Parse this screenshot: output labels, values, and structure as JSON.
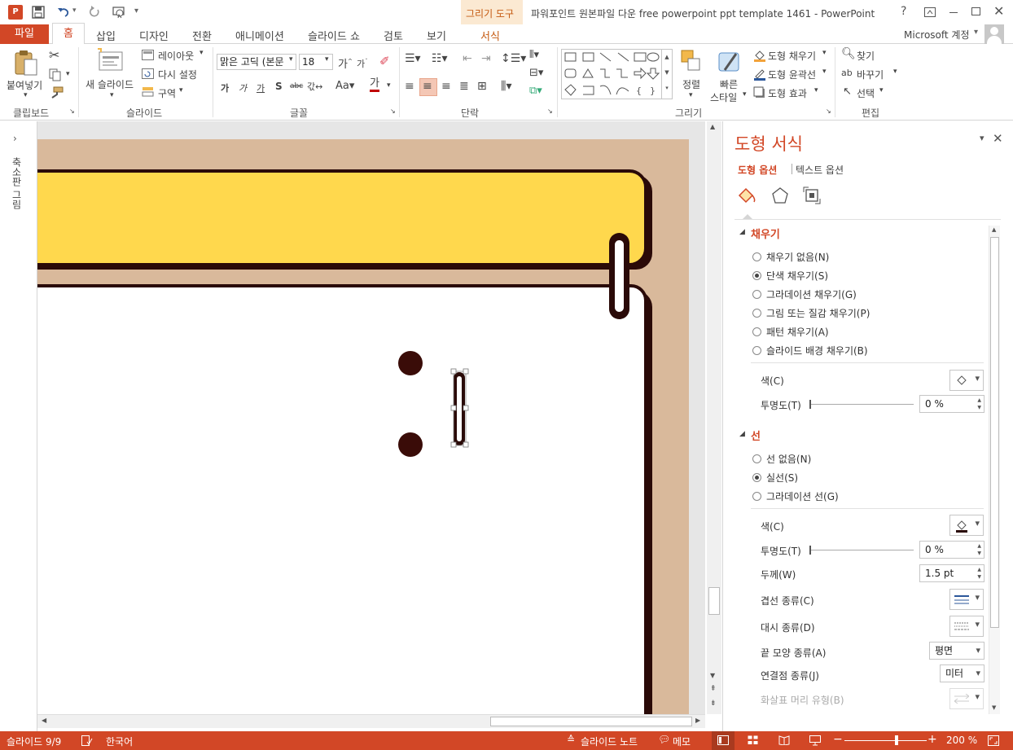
{
  "window": {
    "title": "파워포인트 원본파일 다운 free powerpoint ppt template 1461 - PowerPoint",
    "help": "?",
    "account": "Microsoft 계정"
  },
  "context_tab_group": "그리기 도구",
  "tabs": [
    {
      "label": "파일"
    },
    {
      "label": "홈"
    },
    {
      "label": "삽입"
    },
    {
      "label": "디자인"
    },
    {
      "label": "전환"
    },
    {
      "label": "애니메이션"
    },
    {
      "label": "슬라이드 쇼"
    },
    {
      "label": "검토"
    },
    {
      "label": "보기"
    },
    {
      "label": "서식"
    }
  ],
  "ribbon": {
    "clipboard": {
      "paste": "붙여넣기",
      "group": "클립보드"
    },
    "slides": {
      "new_slide": "새 슬라이드",
      "layout": "레이아웃",
      "reset": "다시 설정",
      "section": "구역",
      "group": "슬라이드"
    },
    "font": {
      "font_name": "맑은 고딕 (본문",
      "font_size": "18",
      "group": "글꼴"
    },
    "paragraph": {
      "group": "단락"
    },
    "drawing": {
      "arrange": "정렬",
      "quick_styles_line1": "빠른",
      "quick_styles_line2": "스타일",
      "shape_fill": "도형 채우기",
      "shape_outline": "도형 윤곽선",
      "shape_effects": "도형 효과",
      "group": "그리기"
    },
    "editing": {
      "find": "찾기",
      "replace": "바꾸기",
      "select": "선택",
      "group": "편집"
    }
  },
  "left_pane": {
    "label": "축소판 그림"
  },
  "format_pane": {
    "title": "도형 서식",
    "tab_shape": "도형 옵션",
    "tab_text": "텍스트 옵션",
    "fill_section": "채우기",
    "fill_options": [
      {
        "label": "채우기 없음(N)",
        "selected": false
      },
      {
        "label": "단색 채우기(S)",
        "selected": true
      },
      {
        "label": "그라데이션 채우기(G)",
        "selected": false
      },
      {
        "label": "그림 또는 질감 채우기(P)",
        "selected": false
      },
      {
        "label": "패턴 채우기(A)",
        "selected": false
      },
      {
        "label": "슬라이드 배경 채우기(B)",
        "selected": false
      }
    ],
    "fill_color_label": "색(C)",
    "fill_transparency_label": "투명도(T)",
    "fill_transparency_value": "0 %",
    "line_section": "선",
    "line_options": [
      {
        "label": "선 없음(N)",
        "selected": false
      },
      {
        "label": "실선(S)",
        "selected": true
      },
      {
        "label": "그라데이션 선(G)",
        "selected": false
      }
    ],
    "line_color_label": "색(C)",
    "line_transparency_label": "투명도(T)",
    "line_transparency_value": "0 %",
    "width_label": "두께(W)",
    "width_value": "1.5 pt",
    "compound_label": "겹선 종류(C)",
    "dash_label": "대시 종류(D)",
    "cap_label": "끝 모양 종류(A)",
    "cap_value": "평면",
    "join_label": "연결점 종류(J)",
    "join_value": "미터",
    "arrow_label": "화살표 머리 유형(B)"
  },
  "status": {
    "slide": "슬라이드 9/9",
    "language": "한국어",
    "notes": "슬라이드 노트",
    "comments": "메모",
    "zoom": "200 %"
  },
  "colors": {
    "accent": "#d24726",
    "slide_tan": "#d9b99b",
    "banner_yellow": "#ffd84d",
    "outline_dark": "#2a0a08"
  }
}
